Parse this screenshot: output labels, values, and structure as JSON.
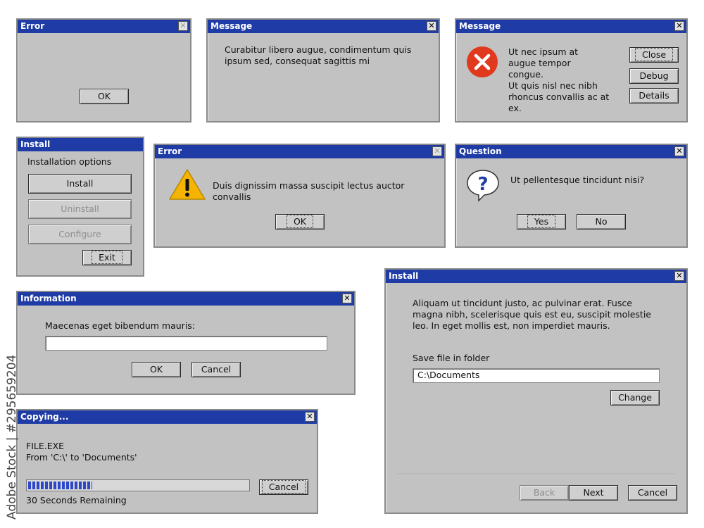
{
  "dialogs": {
    "error1": {
      "title": "Error",
      "ok": "OK"
    },
    "message1": {
      "title": "Message",
      "text": "Curabitur libero augue, condimentum quis ipsum sed, consequat sagittis mi"
    },
    "message2": {
      "title": "Message",
      "line1": "Ut nec ipsum at augue tempor congue.",
      "line2": "Ut quis nisl nec nibh rhoncus convallis ac at ex.",
      "close": "Close",
      "debug": "Debug",
      "details": "Details"
    },
    "install1": {
      "title": "Install",
      "heading": "Installation options",
      "install": "Install",
      "uninstall": "Uninstall",
      "configure": "Configure",
      "exit": "Exit"
    },
    "error2": {
      "title": "Error",
      "text": "Duis dignissim massa suscipit lectus auctor convallis",
      "ok": "OK"
    },
    "question": {
      "title": "Question",
      "text": "Ut pellentesque tincidunt nisi?",
      "yes": "Yes",
      "no": "No"
    },
    "information": {
      "title": "Information",
      "label": "Maecenas eget bibendum mauris:",
      "value": "",
      "ok": "OK",
      "cancel": "Cancel"
    },
    "install2": {
      "title": "Install",
      "text": "Aliquam ut tincidunt justo, ac pulvinar erat. Fusce magna nibh, scelerisque quis est eu, suscipit molestie leo. In eget mollis est, non imperdiet mauris.",
      "folder_label": "Save file in folder",
      "folder_value": "C:\\Documents",
      "change": "Change",
      "back": "Back",
      "next": "Next",
      "cancel": "Cancel"
    },
    "copying": {
      "title": "Copying...",
      "file": "FILE.EXE",
      "from": "From 'C:\\' to 'Documents'",
      "progress": 0.3,
      "remaining": "30 Seconds Remaining",
      "cancel": "Cancel"
    }
  },
  "colors": {
    "titlebar": "#1f3ca6",
    "window": "#c2c2c2",
    "error_icon": "#e0391e",
    "warning_icon": "#f5b400",
    "question_icon": "#1f3ca6"
  },
  "icons": {
    "close": "close-icon",
    "error": "error-icon",
    "warning": "warning-icon",
    "question": "question-icon"
  },
  "watermark": "295659204"
}
